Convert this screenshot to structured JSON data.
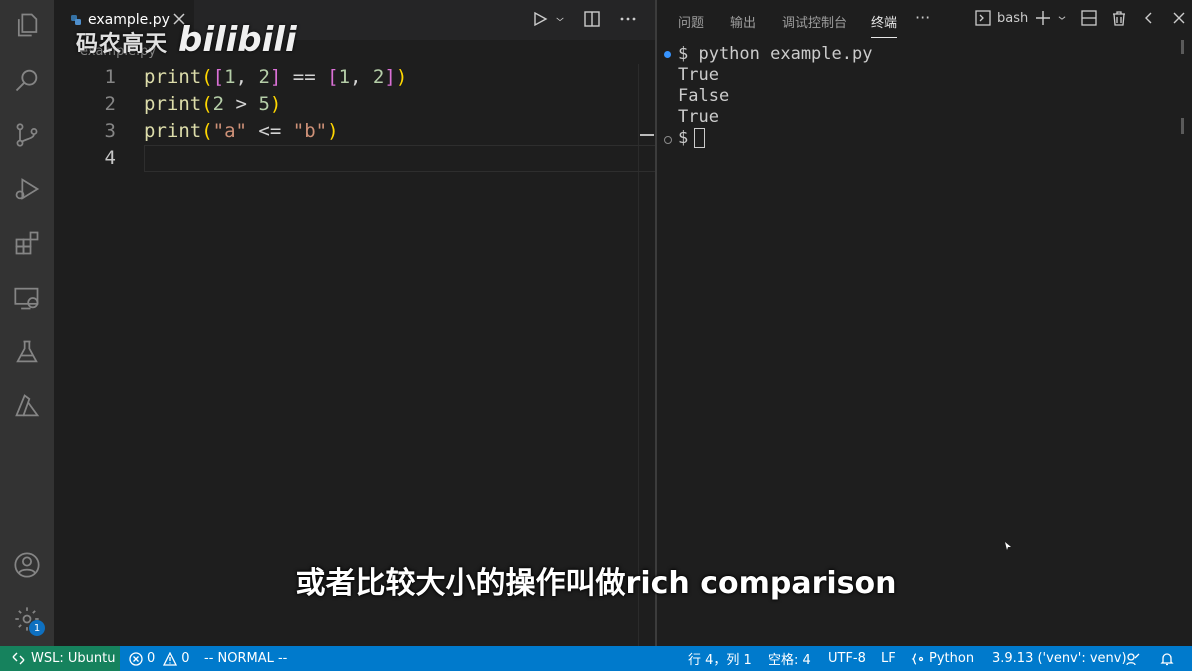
{
  "watermark": {
    "channel": "码农高天",
    "logo": "bilibili"
  },
  "editor": {
    "tab_label": "example.py",
    "breadcrumb": "example.py",
    "lines": [
      {
        "num": "1"
      },
      {
        "num": "2"
      },
      {
        "num": "3"
      },
      {
        "num": "4"
      }
    ],
    "code": {
      "l1": {
        "fn": "print",
        "p1": "(",
        "b1": "[",
        "a": "1",
        "c1": ", ",
        "b": "2",
        "b2": "]",
        "op": " == ",
        "b3": "[",
        "c": "1",
        "c2": ", ",
        "d": "2",
        "b4": "]",
        "p2": ")"
      },
      "l2": {
        "fn": "print",
        "p1": "(",
        "a": "2",
        "op": " > ",
        "b": "5",
        "p2": ")"
      },
      "l3": {
        "fn": "print",
        "p1": "(",
        "a": "\"a\"",
        "op": " <= ",
        "b": "\"b\"",
        "p2": ")"
      }
    }
  },
  "panel": {
    "tabs": [
      "问题",
      "输出",
      "调试控制台",
      "终端"
    ],
    "active_tab": "终端",
    "more": "···",
    "terminal_name": "bash",
    "terminal_lines": [
      "$ python example.py",
      "True",
      "False",
      "True",
      "$"
    ]
  },
  "subtitle": "或者比较大小的操作叫做rich comparison",
  "activity_bar": {
    "icons": [
      "explorer-icon",
      "search-icon",
      "source-control-icon",
      "run-debug-icon",
      "extensions-icon",
      "remote-explorer-icon",
      "testing-icon",
      "azure-icon",
      "account-icon",
      "settings-icon"
    ],
    "settings_badge": "1"
  },
  "statusbar": {
    "remote": "WSL: Ubuntu",
    "errors": "0",
    "warnings": "0",
    "vim_mode": "-- NORMAL --",
    "position": "行 4，列 1",
    "spaces": "空格: 4",
    "encoding": "UTF-8",
    "eol": "LF",
    "language": "Python",
    "interpreter": "3.9.13 ('venv': venv)"
  },
  "colors": {
    "accent": "#007acc",
    "remote": "#16825d",
    "activity_bar": "#333333",
    "editor_bg": "#1e1e1e"
  }
}
